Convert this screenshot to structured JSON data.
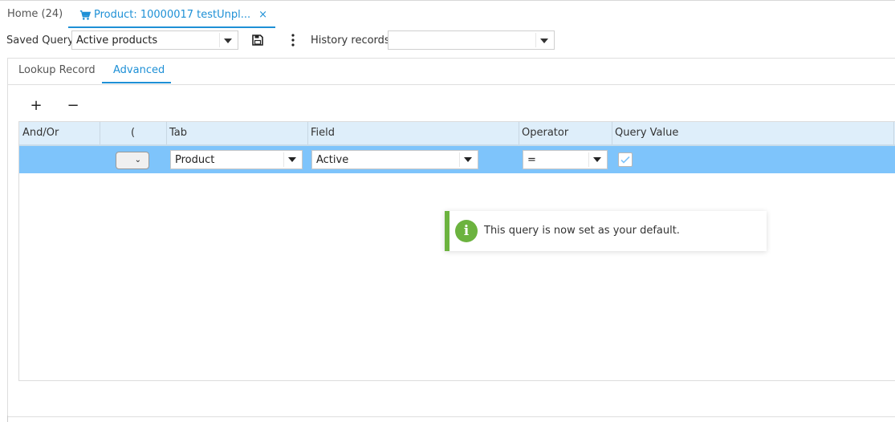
{
  "tabs": {
    "home_label": "Home (24)",
    "product_label": "Product: 10000017 testUnpl...",
    "close_glyph": "×"
  },
  "query": {
    "saved_query_label": "Saved Query",
    "saved_query_value": "Active products",
    "history_label": "History records",
    "history_value": ""
  },
  "panel": {
    "tabs": [
      "Lookup Record",
      "Advanced"
    ],
    "active_tab": "Advanced",
    "add_glyph": "+",
    "remove_glyph": "−"
  },
  "grid": {
    "headers": [
      "And/Or",
      "(",
      "Tab",
      "Field",
      "Operator",
      "Query Value"
    ],
    "row": {
      "and_or": "",
      "paren": "",
      "tab": "Product",
      "field": "Active",
      "operator": "=",
      "query_value_checked": true
    },
    "row_color": "#7ec4fb",
    "header_color": "#deeefa"
  },
  "toast": {
    "message": "This query is now set as your default.",
    "icon": "info-icon",
    "icon_glyph": "i",
    "accent": "#6cb33f"
  },
  "accent": "#1e90d6"
}
